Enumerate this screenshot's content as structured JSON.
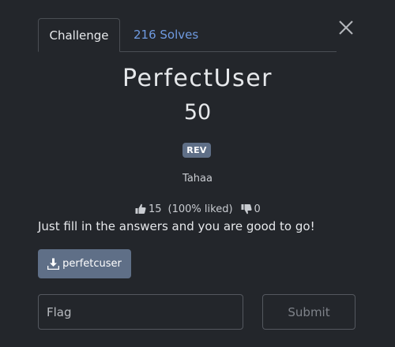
{
  "modal": {
    "tabs": [
      {
        "label": "Challenge",
        "active": true
      },
      {
        "label": "216 Solves",
        "active": false
      }
    ],
    "close_icon": "close-icon"
  },
  "challenge": {
    "title": "PerfectUser",
    "points": "50",
    "tag": "REV",
    "author": "Tahaa",
    "ratings": {
      "likes": "15",
      "liked_pct": "(100% liked)",
      "dislikes": "0"
    },
    "description": "Just fill in the answers and you are good to go!",
    "file": {
      "label": "perfetcuser",
      "icon": "download-icon"
    }
  },
  "submission": {
    "flag_placeholder": "Flag",
    "flag_value": "",
    "submit_label": "Submit"
  },
  "colors": {
    "background": "#23262b",
    "accent_link": "#6f9ae0",
    "button": "#5f6f87",
    "border": "#54585f"
  }
}
